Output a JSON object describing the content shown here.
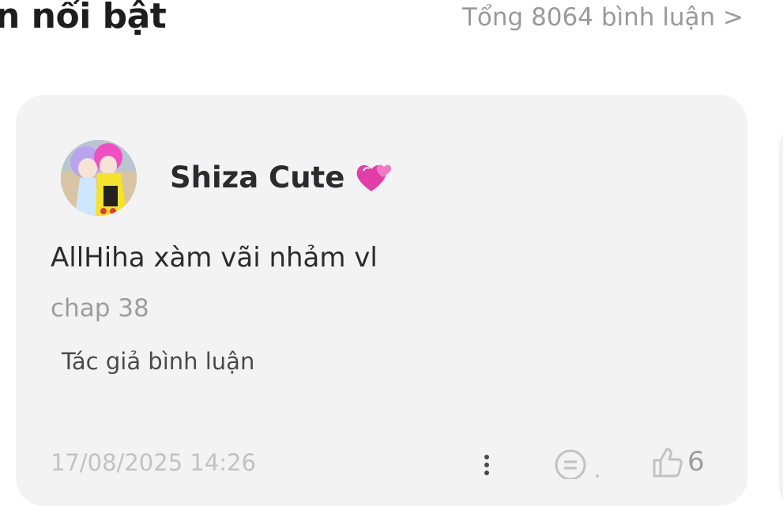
{
  "header": {
    "title": "n nổi bật",
    "total_comments_link": "Tổng 8064 bình luận >"
  },
  "comment": {
    "username": "Shiza Cute",
    "username_badge_icon": "two-hearts-icon",
    "text": "AllHiha xàm vãi nhảm vl",
    "chapter": "chap 38",
    "author_note": "Tác giả bình luận",
    "timestamp": "17/08/2025 14:26",
    "likes": "6",
    "icons": {
      "more": "more-vertical-icon",
      "reply": "reply-bubble-icon",
      "like": "thumbs-up-icon"
    }
  },
  "colors": {
    "card_background": "#f3f3f4",
    "muted_text": "#9d9d9d",
    "primary_text": "#2b2b2e",
    "badge_pink": "#e23ea8"
  }
}
